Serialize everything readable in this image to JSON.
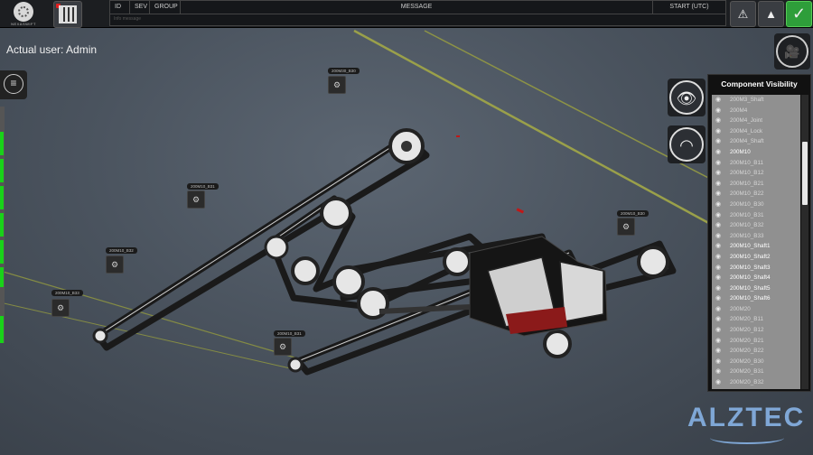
{
  "logo": {
    "text": "NEXASWIFT"
  },
  "alarm_table": {
    "columns": [
      "ID",
      "SEV",
      "GROUP",
      "MESSAGE",
      "START (UTC)"
    ],
    "row_hint": "Info message"
  },
  "user": {
    "label": "Actual user:",
    "name": "Admin"
  },
  "component_visibility": {
    "title": "Component Visibility",
    "items": [
      {
        "label": "200M3_Shaft",
        "visible": false
      },
      {
        "label": "200M4",
        "visible": false
      },
      {
        "label": "200M4_Joint",
        "visible": false
      },
      {
        "label": "200M4_Lock",
        "visible": false
      },
      {
        "label": "200M4_Shaft",
        "visible": false
      },
      {
        "label": "200M10",
        "visible": true
      },
      {
        "label": "200M10_B11",
        "visible": false
      },
      {
        "label": "200M10_B12",
        "visible": false
      },
      {
        "label": "200M10_B21",
        "visible": false
      },
      {
        "label": "200M10_B22",
        "visible": false
      },
      {
        "label": "200M10_B30",
        "visible": false
      },
      {
        "label": "200M10_B31",
        "visible": false
      },
      {
        "label": "200M10_B32",
        "visible": false
      },
      {
        "label": "200M10_B33",
        "visible": false
      },
      {
        "label": "200M10_Shaft1",
        "visible": true
      },
      {
        "label": "200M10_Shaft2",
        "visible": true
      },
      {
        "label": "200M10_Shaft3",
        "visible": true
      },
      {
        "label": "200M10_Shaft4",
        "visible": true
      },
      {
        "label": "200M10_Shaft5",
        "visible": true
      },
      {
        "label": "200M10_Shaft6",
        "visible": true
      },
      {
        "label": "200M20",
        "visible": false
      },
      {
        "label": "200M20_B11",
        "visible": false
      },
      {
        "label": "200M20_B12",
        "visible": false
      },
      {
        "label": "200M20_B21",
        "visible": false
      },
      {
        "label": "200M20_B22",
        "visible": false
      },
      {
        "label": "200M20_B30",
        "visible": false
      },
      {
        "label": "200M20_B31",
        "visible": false
      },
      {
        "label": "200M20_B32",
        "visible": false
      }
    ]
  },
  "sensor_tags": {
    "b30_top": "200M30_B30",
    "b31": "200M10_B31",
    "b32": "200M10_B32",
    "b33": "200M10_B33",
    "b30_right": "200M10_B30",
    "b31_bottom": "200M10_B31"
  },
  "brand": {
    "text": "ALZTEC"
  },
  "colors": {
    "accent_green": "#19d219",
    "ok_green": "#2e9e3a",
    "laser": "#9aa04a",
    "brand_blue": "#7fa7d6"
  }
}
